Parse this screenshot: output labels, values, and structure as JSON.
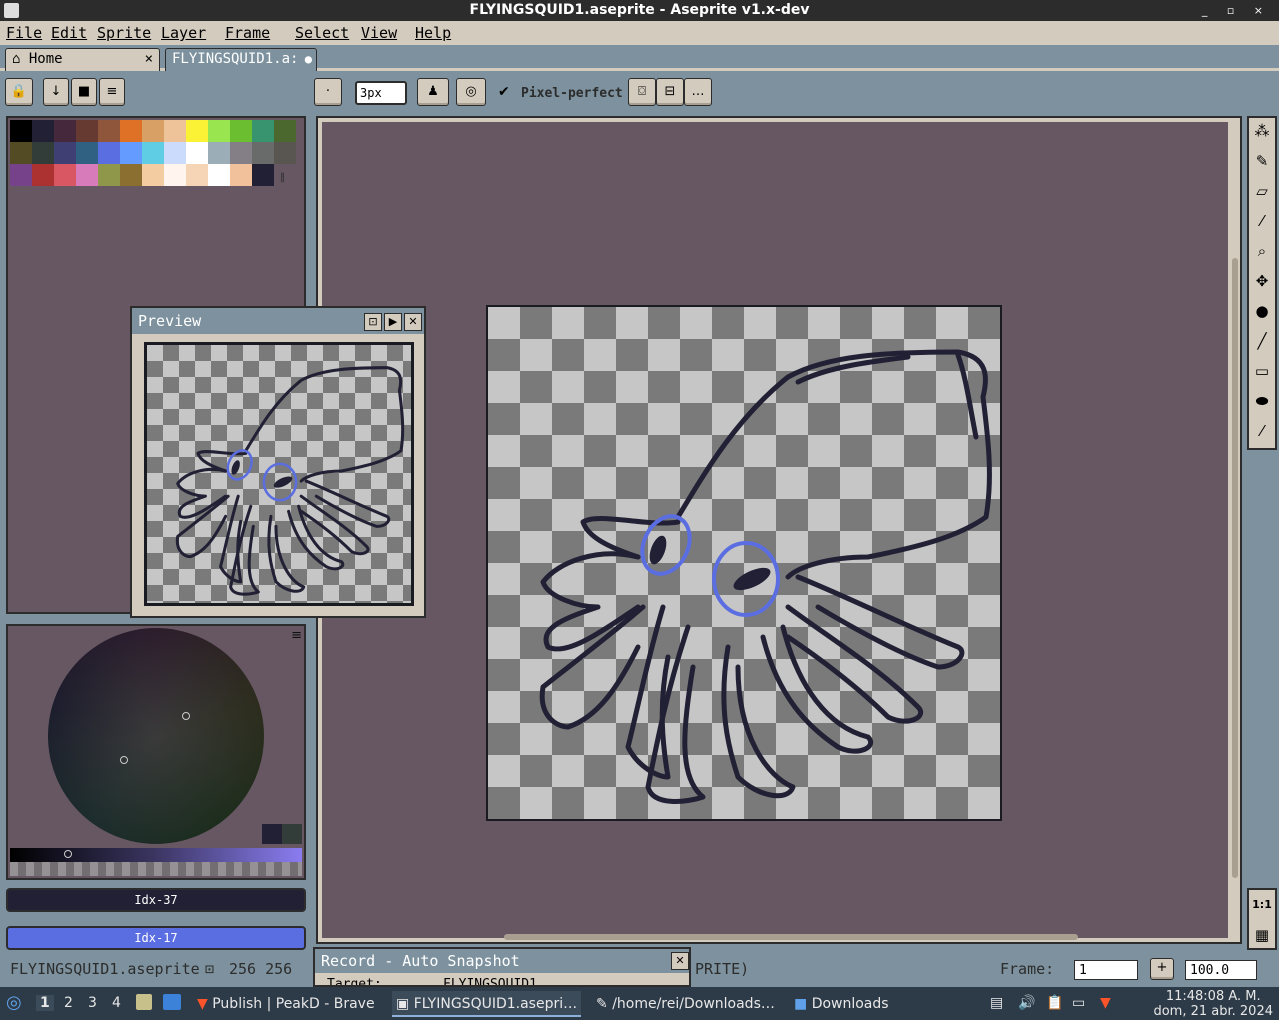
{
  "window": {
    "title": "FLYINGSQUID1.aseprite - Aseprite v1.x-dev",
    "controls": "_ ▫ ×"
  },
  "menu": [
    "File",
    "Edit",
    "Sprite",
    "Layer",
    "Frame",
    "Select",
    "View",
    "Help"
  ],
  "tabs": [
    {
      "label": "Home",
      "close": "×"
    },
    {
      "label": "FLYINGSQUID1.a:",
      "close": "●"
    }
  ],
  "toolbar": {
    "brush_size": "3px",
    "pixel_perfect_label": "Pixel-perfect",
    "pixel_perfect_checked": true
  },
  "palette": [
    "#000000",
    "#222034",
    "#45283c",
    "#663931",
    "#8f563b",
    "#df7126",
    "#d9a066",
    "#eec39a",
    "#fbf236",
    "#99e550",
    "#6abe30",
    "#37946e",
    "#4b692f",
    "#524b24",
    "#323c39",
    "#3f3f74",
    "#306082",
    "#5b6ee1",
    "#639bff",
    "#5fcde4",
    "#cbdbfc",
    "#ffffff",
    "#9badb7",
    "#847e87",
    "#696a6a",
    "#595652",
    "#76428a",
    "#ac3232",
    "#d95763",
    "#d77bba",
    "#8f974a",
    "#8a6f30",
    "#f4cca1",
    "#fff5ee",
    "#f5d5b6",
    "#ffffff",
    "#f0c19b",
    "#222034"
  ],
  "colors": {
    "foreground_label": "Idx-37",
    "foreground": "#222034",
    "background_label": "Idx-17",
    "background": "#5b6ee1"
  },
  "preview": {
    "title": "Preview"
  },
  "record": {
    "title": "Record - Auto Snapshot",
    "target_label": "Target:",
    "target_value": "FLYINGSQUID1"
  },
  "status": {
    "filename": "FLYINGSQUID1.aseprite",
    "size": "256 256",
    "sprite_tag": "PRITE)",
    "frame_label": "Frame:",
    "frame_value": "1",
    "zoom": "100.0"
  },
  "taskbar": {
    "workspaces": [
      "1",
      "2",
      "3",
      "4"
    ],
    "windows": [
      "Publish | PeakD - Brave",
      "FLYINGSQUID1.asepri…",
      "/home/rei/Downloads…",
      "Downloads"
    ],
    "clock_time": "11:48:08 A. M.",
    "clock_date": "dom, 21 abr. 2024"
  }
}
